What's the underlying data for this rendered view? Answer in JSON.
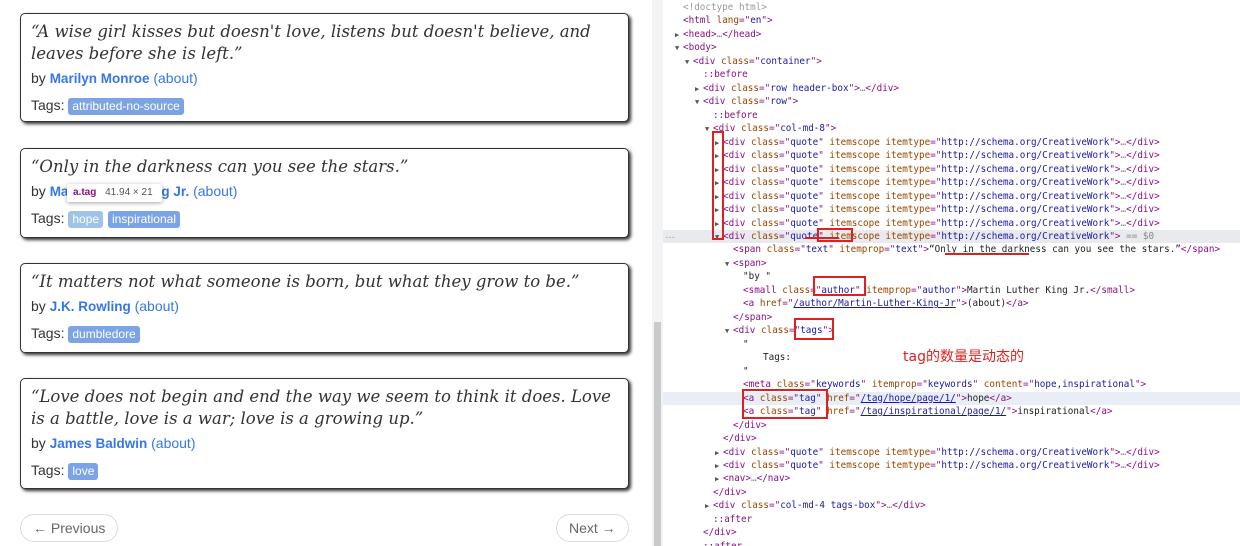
{
  "quotes": [
    {
      "text": "“A wise girl kisses but doesn't love, listens but doesn't believe, and leaves before she is left.”",
      "by": "by",
      "author": "Marilyn Monroe",
      "about": "(about)",
      "tags_label": "Tags:",
      "tags": [
        "attributed-no-source"
      ]
    },
    {
      "text": "“Only in the darkness can you see the stars.”",
      "by": "by",
      "author": "Martin Luther King Jr.",
      "about": "(about)",
      "tags_label": "Tags:",
      "tags": [
        "hope",
        "inspirational"
      ]
    },
    {
      "text": "“It matters not what someone is born, but what they grow to be.”",
      "by": "by",
      "author": "J.K. Rowling",
      "about": "(about)",
      "tags_label": "Tags:",
      "tags": [
        "dumbledore"
      ]
    },
    {
      "text": "“Love does not begin and end the way we seem to think it does. Love is a battle, love is a war; love is a growing up.”",
      "by": "by",
      "author": "James Baldwin",
      "about": "(about)",
      "tags_label": "Tags:",
      "tags": [
        "love"
      ]
    }
  ],
  "pager": {
    "previous": "← Previous",
    "next": "Next →"
  },
  "inspect_tooltip": {
    "selector": "a.tag",
    "size": "41.94 × 21"
  },
  "annotation": "tag的数量是动态的",
  "devtools": {
    "doctype": "<!doctype html>",
    "quote_itemtype": "http://schema.org/CreativeWork",
    "dollar0": "== $0",
    "selected_quote_text": "“Only in the darkness can you see the stars.”",
    "by_text": "\"by \"",
    "author_name": "Martin Luther King Jr.",
    "author_href": "/author/Martin-Luther-King-Jr",
    "about": "(about)",
    "tags_text": "Tags:",
    "keywords": "hope,inspirational",
    "tag_hrefs": [
      "/tag/hope/page/1/",
      "/tag/inspirational/page/1/"
    ],
    "tag_names": [
      "hope",
      "inspirational"
    ]
  }
}
